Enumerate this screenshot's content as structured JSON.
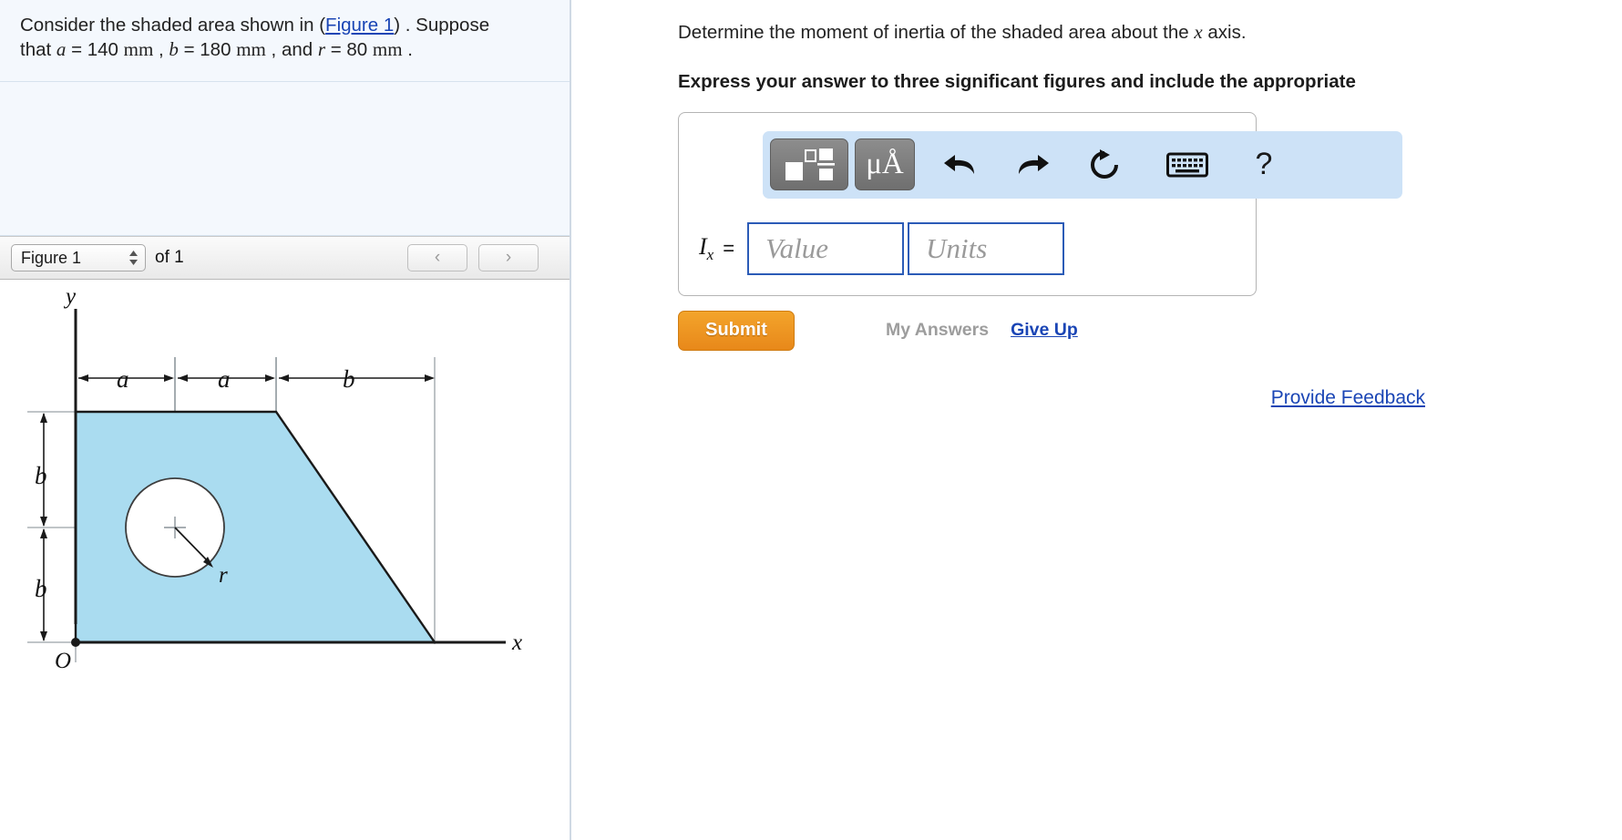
{
  "problem": {
    "text_before_link": "Consider the shaded area shown in (",
    "figure_link": "Figure 1",
    "text_after_link": ") . Suppose",
    "line2_prefix": "that ",
    "var_a": "a",
    "a_value": " = 140 ",
    "unit_mm_1": "mm",
    "sep1": " , ",
    "var_b": "b",
    "b_value": " = 180 ",
    "unit_mm_2": "mm",
    "sep2": " , and ",
    "var_r": "r",
    "r_value": " = 80 ",
    "unit_mm_3": "mm",
    "period": " ."
  },
  "figure_nav": {
    "selected": "Figure 1",
    "of_text": "of 1",
    "prev_label": "‹",
    "next_label": "›"
  },
  "figure": {
    "axis_y": "y",
    "axis_x": "x",
    "origin": "O",
    "dim_a1": "a",
    "dim_a2": "a",
    "dim_b_top": "b",
    "dim_b_left_upper": "b",
    "dim_b_left_lower": "b",
    "radius_label": "r",
    "shade_color": "#aadcf0",
    "outline_color": "#1a1a1a"
  },
  "question": {
    "prompt_prefix": "Determine the moment of inertia of the shaded area about the ",
    "prompt_var": "x",
    "prompt_suffix": " axis.",
    "instruction": "Express your answer to three significant figures and include the appropriate"
  },
  "toolbar": {
    "template_button": "template-icon",
    "units_button": "μÅ",
    "undo": "undo-icon",
    "redo": "redo-icon",
    "reset": "reset-icon",
    "keyboard": "keyboard-icon",
    "help": "?"
  },
  "answer": {
    "variable": "I",
    "subscript": "x",
    "equals": "=",
    "value_placeholder": "Value",
    "units_placeholder": "Units"
  },
  "actions": {
    "submit": "Submit",
    "my_answers": "My Answers",
    "give_up": "Give Up",
    "provide_feedback": "Provide Feedback"
  }
}
